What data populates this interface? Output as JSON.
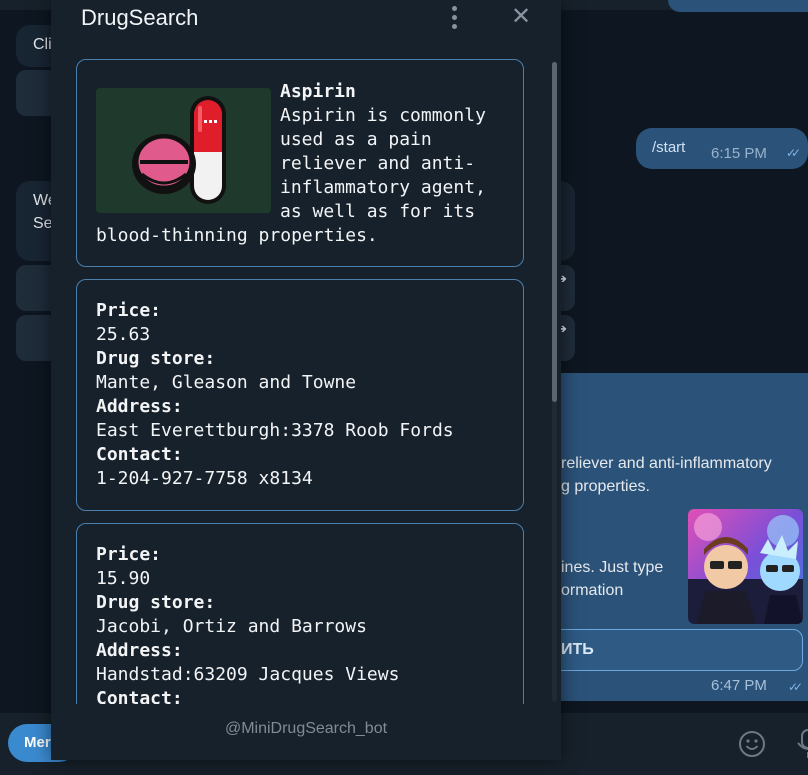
{
  "background_chat": {
    "incoming_snippet_1": "Cli",
    "incoming_snippet_2a": "We",
    "incoming_snippet_2b": "Se",
    "outgoing_command": "/start",
    "outgoing_time": "6:15 PM",
    "bot_message_line_1": "reliever and anti-inflammatory",
    "bot_message_line_2": "g properties.",
    "bot_message_line_3": "ines. Just type",
    "bot_message_line_4": "ormation",
    "bot_button_label": "ИТЬ",
    "bot_message_time": "6:47 PM",
    "menu_button_label": "Mer"
  },
  "panel": {
    "title": "DrugSearch",
    "bot_username": "@MiniDrugSearch_bot"
  },
  "drug": {
    "name": "Aspirin",
    "description": "Aspirin is commonly used as a pain reliever and anti-inflammatory agent, as well as for its blood-thinning properties."
  },
  "labels": {
    "price": "Price:",
    "drug_store": "Drug store:",
    "address": "Address:",
    "contact": "Contact:"
  },
  "offers": [
    {
      "price": "25.63",
      "store": "Mante, Gleason and Towne",
      "address": "East Everettburgh:3378 Roob Fords",
      "contact": "1-204-927-7758 x8134"
    },
    {
      "price": "15.90",
      "store": "Jacobi, Ortiz and Barrows",
      "address": "Handstad:63209 Jacques Views",
      "contact": ""
    }
  ],
  "colors": {
    "panel_bg": "#17212b",
    "card_border": "#4a7fae",
    "outgoing_bubble": "#2b5278",
    "accent": "#3a8ad0"
  }
}
